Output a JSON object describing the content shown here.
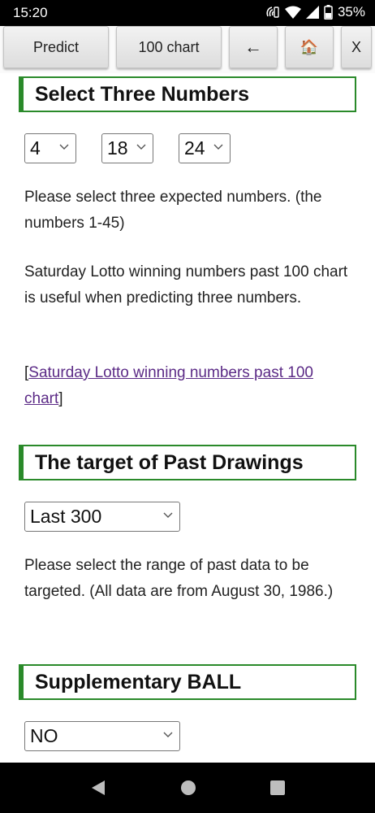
{
  "status": {
    "time": "15:20",
    "battery": "35%"
  },
  "toolbar": {
    "predict_label": "Predict",
    "chart_label": "100 chart",
    "back_label": "←",
    "home_label": "🏠",
    "close_label": "X"
  },
  "section_three_numbers": {
    "title": "Select Three Numbers",
    "selects": [
      "4",
      "18",
      "24"
    ],
    "desc1": "Please select three expected numbers. (the numbers 1-45)",
    "desc2": "Saturday Lotto winning numbers past 100 chart is useful when predicting three numbers.",
    "link_open": "[",
    "link_text": "Saturday Lotto winning numbers past 100 chart",
    "link_close": "]"
  },
  "section_past": {
    "title": "The target of Past Drawings",
    "select_value": "Last 300",
    "desc": "Please select the range of past data to be targeted. (All data are from August 30, 1986.)"
  },
  "section_supp": {
    "title": "Supplementary BALL",
    "select_value": "NO"
  }
}
